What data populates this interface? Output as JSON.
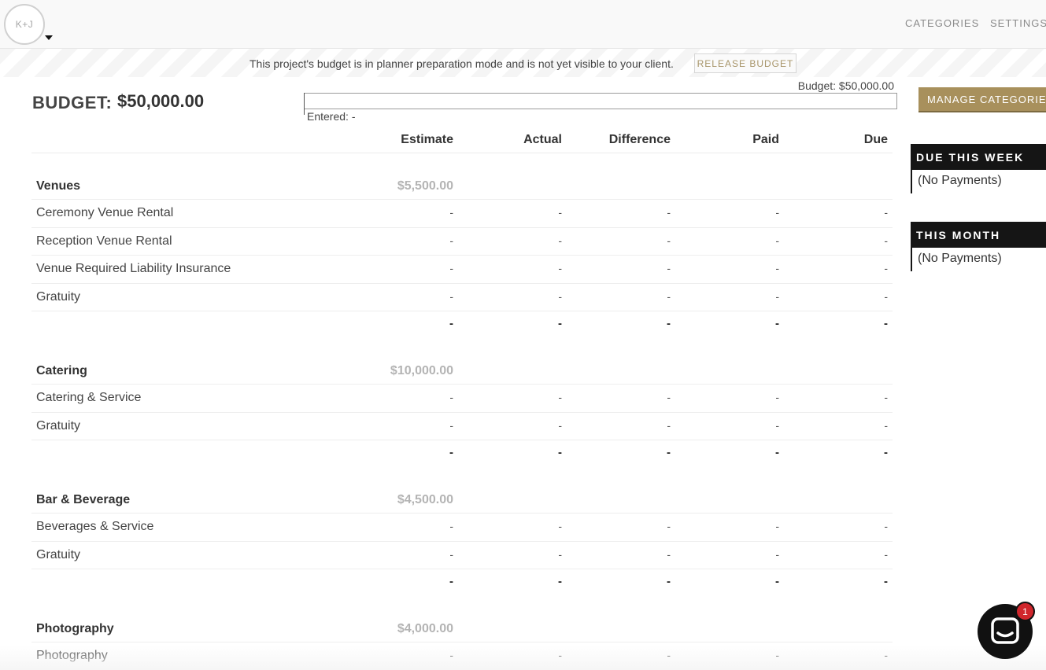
{
  "header": {
    "avatar_initials": "K+J",
    "nav": [
      "CATEGORIES",
      "SETTINGS"
    ]
  },
  "banner": {
    "message": "This project's budget is in planner preparation mode and is not yet visible to your client.",
    "release_label": "RELEASE BUDGET"
  },
  "budget": {
    "label": "BUDGET:",
    "total": "$50,000.00",
    "bar_budget_text": "Budget: $50,000.00",
    "bar_entered_text": "Entered: -",
    "entered_fraction": 0,
    "manage_label": "MANAGE CATEGORIES"
  },
  "table": {
    "columns": [
      "Estimate",
      "Actual",
      "Difference",
      "Paid",
      "Due"
    ],
    "categories": [
      {
        "name": "Venues",
        "estimate": "$5,500.00",
        "items": [
          {
            "name": "Ceremony Venue Rental",
            "values": [
              "-",
              "-",
              "-",
              "-",
              "-"
            ]
          },
          {
            "name": "Reception Venue Rental",
            "values": [
              "-",
              "-",
              "-",
              "-",
              "-"
            ]
          },
          {
            "name": "Venue Required Liability Insurance",
            "values": [
              "-",
              "-",
              "-",
              "-",
              "-"
            ]
          },
          {
            "name": "Gratuity",
            "values": [
              "-",
              "-",
              "-",
              "-",
              "-"
            ]
          }
        ],
        "totals": [
          "-",
          "-",
          "-",
          "-",
          "-"
        ]
      },
      {
        "name": "Catering",
        "estimate": "$10,000.00",
        "items": [
          {
            "name": "Catering & Service",
            "values": [
              "-",
              "-",
              "-",
              "-",
              "-"
            ]
          },
          {
            "name": "Gratuity",
            "values": [
              "-",
              "-",
              "-",
              "-",
              "-"
            ]
          }
        ],
        "totals": [
          "-",
          "-",
          "-",
          "-",
          "-"
        ]
      },
      {
        "name": "Bar & Beverage",
        "estimate": "$4,500.00",
        "items": [
          {
            "name": "Beverages & Service",
            "values": [
              "-",
              "-",
              "-",
              "-",
              "-"
            ]
          },
          {
            "name": "Gratuity",
            "values": [
              "-",
              "-",
              "-",
              "-",
              "-"
            ]
          }
        ],
        "totals": [
          "-",
          "-",
          "-",
          "-",
          "-"
        ]
      },
      {
        "name": "Photography",
        "estimate": "$4,000.00",
        "items": [
          {
            "name": "Photography",
            "values": [
              "-",
              "-",
              "-",
              "-",
              "-"
            ]
          }
        ],
        "totals": null
      }
    ]
  },
  "sidebar": {
    "due_this_week": {
      "title": "DUE THIS WEEK",
      "body": "(No Payments)"
    },
    "this_month": {
      "title": "THIS MONTH",
      "body": "(No Payments)"
    }
  },
  "chat": {
    "badge_count": "1",
    "icon": "chat-icon"
  },
  "colors": {
    "accent": "#a8905c",
    "panel_dark": "#151515",
    "badge_red": "#d0262c"
  }
}
